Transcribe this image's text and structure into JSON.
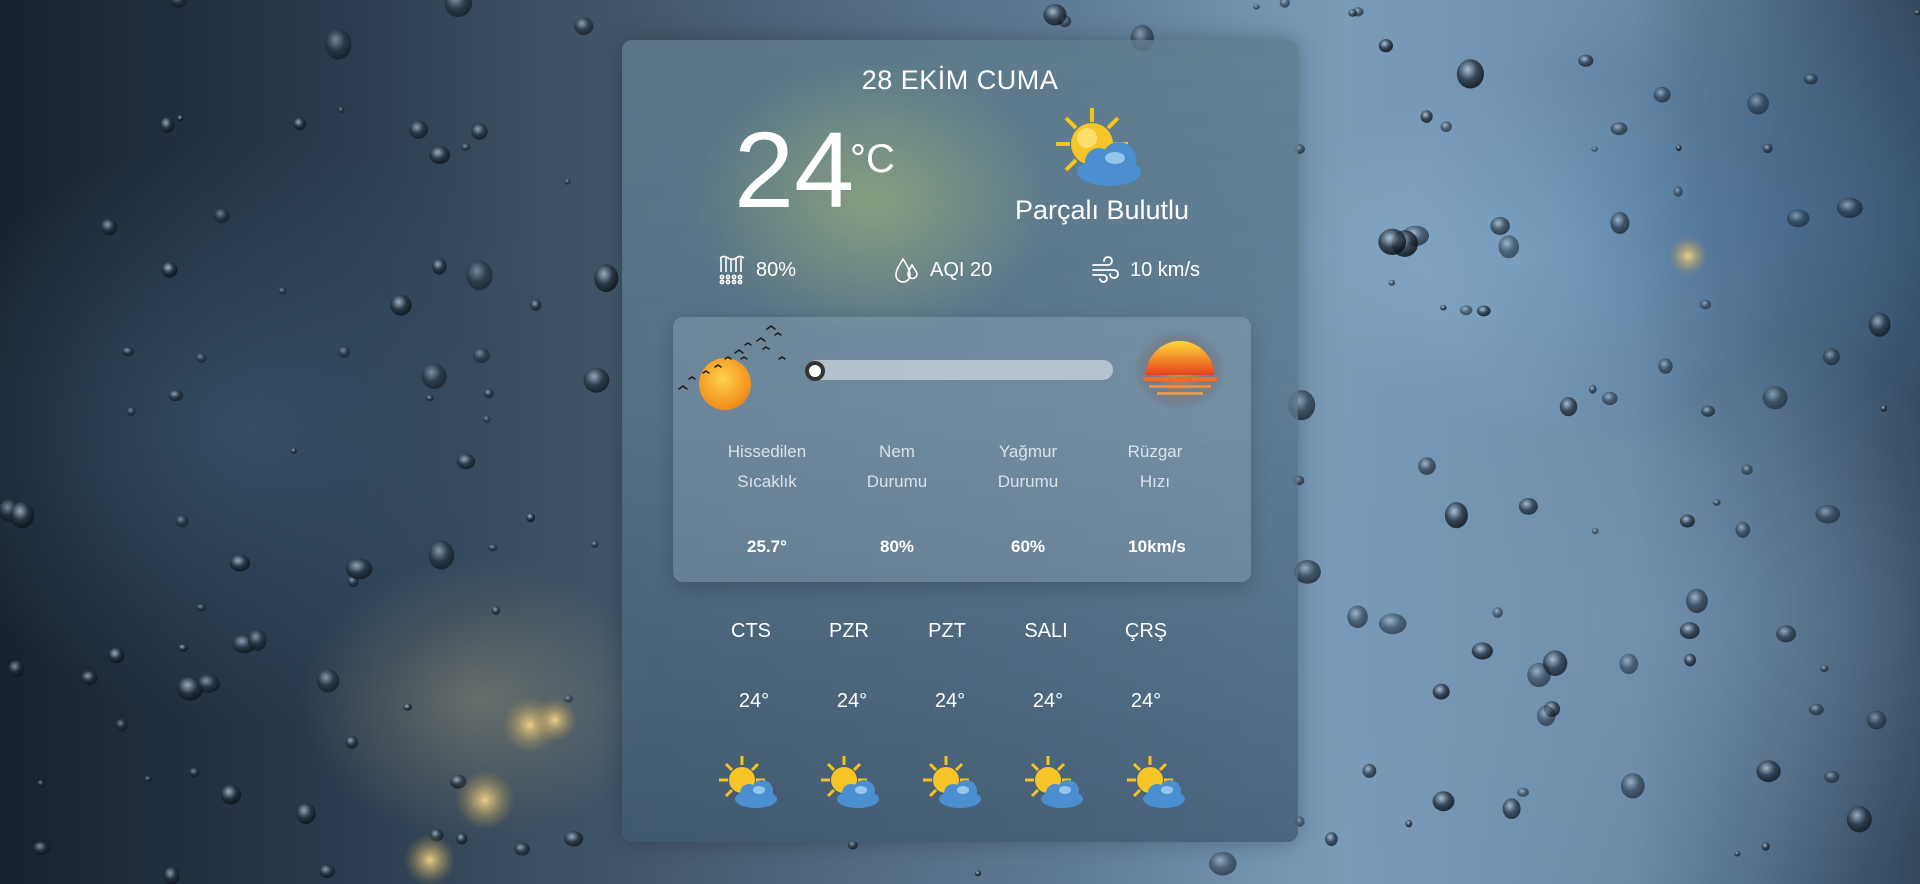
{
  "date_heading": "28 EKİM CUMA",
  "current": {
    "temperature": "24",
    "unit": "°C",
    "condition": "Parçalı Bulutlu",
    "icon": "partly-cloudy-icon"
  },
  "stats": [
    {
      "icon": "humidity-icon",
      "value": "80%"
    },
    {
      "icon": "air-quality-icon",
      "value": "AQI 20"
    },
    {
      "icon": "wind-icon",
      "value": "10 km/s"
    }
  ],
  "sun_progress": 0.0,
  "details": [
    {
      "label": "Hissedilen\nSıcaklık",
      "value": "25.7°"
    },
    {
      "label": "Nem\nDurumu",
      "value": "80%"
    },
    {
      "label": "Yağmur\nDurumu",
      "value": "60%"
    },
    {
      "label": "Rüzgar\nHızı",
      "value": "10km/s"
    }
  ],
  "forecast": [
    {
      "day": "CTS",
      "temp": "24°",
      "icon": "partly-cloudy-icon"
    },
    {
      "day": "PZR",
      "temp": "24°",
      "icon": "partly-cloudy-icon"
    },
    {
      "day": "PZT",
      "temp": "24°",
      "icon": "partly-cloudy-icon"
    },
    {
      "day": "SALI",
      "temp": "24°",
      "icon": "partly-cloudy-icon"
    },
    {
      "day": "ÇRŞ",
      "temp": "24°",
      "icon": "partly-cloudy-icon"
    }
  ],
  "colors": {
    "text": "#ffffff",
    "sun": "#f5b433",
    "cloud": "#5a9ad6"
  }
}
